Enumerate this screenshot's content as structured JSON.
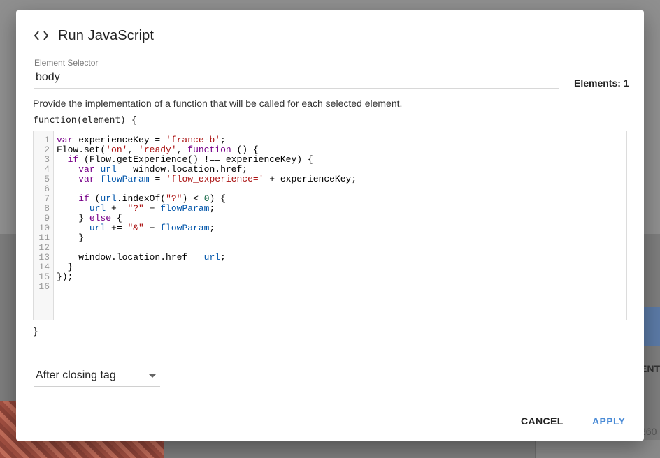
{
  "dialog": {
    "title": "Run JavaScript",
    "title_icon": "code-brackets-icon"
  },
  "selector": {
    "label": "Element Selector",
    "value": "body",
    "elements_count": "Elements: 1"
  },
  "description": "Provide the implementation of a function that will be called for each selected element.",
  "function_open": "function(element) {",
  "function_close": "}",
  "editor": {
    "line_numbers": [
      "1",
      "2",
      "3",
      "4",
      "5",
      "6",
      "7",
      "8",
      "9",
      "10",
      "11",
      "12",
      "13",
      "14",
      "15",
      "16"
    ],
    "lines": [
      "var experienceKey = 'france-b';",
      "Flow.set('on', 'ready', function () {",
      "  if (Flow.getExperience() !== experienceKey) {",
      "    var url = window.location.href;",
      "    var flowParam = 'flow_experience=' + experienceKey;",
      "",
      "    if (url.indexOf(\"?\") < 0) {",
      "      url += \"?\" + flowParam;",
      "    } else {",
      "      url += \"&\" + flowParam;",
      "    }",
      "",
      "    window.location.href = url;",
      "  }",
      "});",
      ""
    ]
  },
  "position_select": {
    "value": "After closing tag"
  },
  "buttons": {
    "cancel": "CANCEL",
    "apply": "APPLY"
  },
  "colors": {
    "accent": "#4a8bd6",
    "keyword": "#770088",
    "string": "#aa1111",
    "variable": "#0055aa",
    "number": "#116644"
  },
  "background": {
    "partial_text": "ENT",
    "partial_number": "260"
  }
}
